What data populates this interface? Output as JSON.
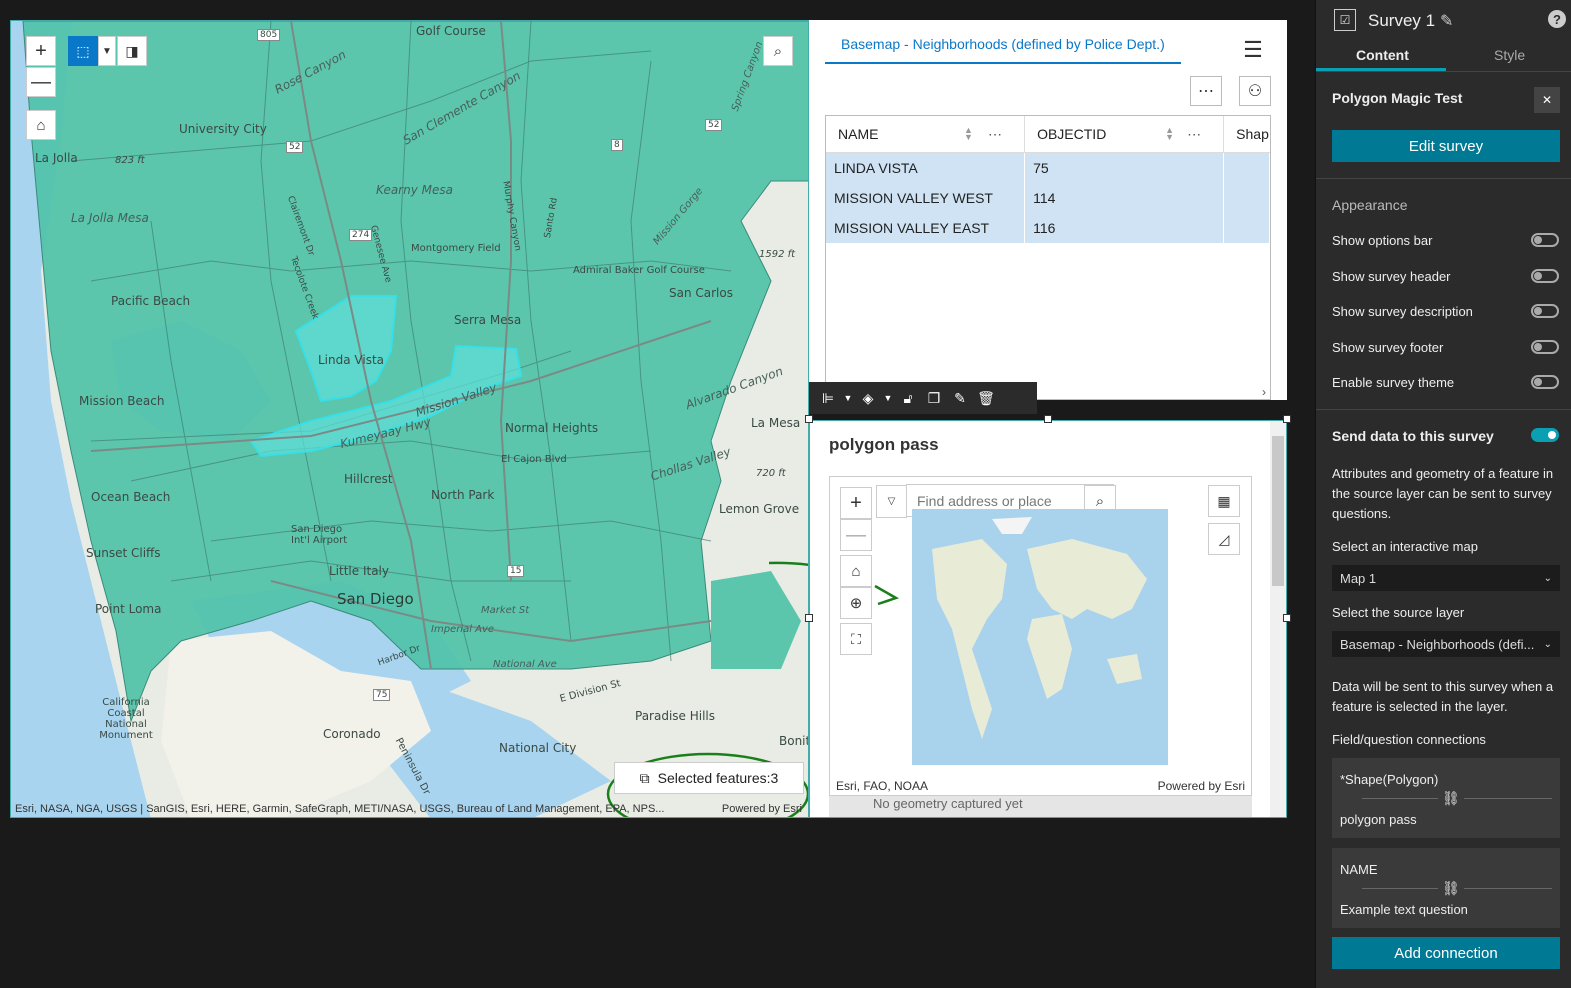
{
  "map": {
    "labels": [
      "Golf Course",
      "University City",
      "La Jolla",
      "La Jolla Mesa",
      "Kearny Mesa",
      "Montgomery Field",
      "Admiral Baker Golf Course",
      "Pacific Beach",
      "Serra Mesa",
      "San Carlos",
      "Linda Vista",
      "Mission Beach",
      "Mission Valley",
      "Kumeyaay Hwy",
      "La Mesa",
      "Normal Heights",
      "El Cajon Blvd",
      "Ocean Beach",
      "Hillcrest",
      "North Park",
      "Lemon Grove",
      "Sunset Cliffs",
      "San Diego Int'l Airport",
      "Little Italy",
      "San Diego",
      "Point Loma",
      "Market St",
      "Imperial Ave",
      "National Ave",
      "California Coastal National Monument",
      "Coronado",
      "National City",
      "Paradise Hills",
      "Rose Canyon",
      "San Clemente Canyon",
      "Alvarado Canyon",
      "Chollas Valley",
      "Spring Canyon",
      "Mission Gorge",
      "Clairemont Dr",
      "Santo Rd",
      "Murphy Canyon",
      "Genesee Ave",
      "Tecolote Creek",
      "Harbor Dr",
      "E Division St",
      "Peninsula Dr",
      "720 ft",
      "1592 ft",
      "823 ft",
      "Bonit"
    ],
    "shields": [
      "805",
      "52",
      "274",
      "52",
      "15",
      "75",
      "8"
    ],
    "attribution": "Esri, NASA, NGA, USGS | SanGIS, Esri, HERE, Garmin, SafeGraph, METI/NASA, USGS, Bureau of Land Management, EPA, NPS...",
    "powered": "Powered by Esri",
    "selected_features": "Selected features:3",
    "zoom_in": "+",
    "zoom_out": "—"
  },
  "table": {
    "tab_label": "Basemap - Neighborhoods (defined by Police Dept.)",
    "columns": [
      "NAME",
      "OBJECTID",
      "Shap"
    ],
    "rows": [
      {
        "name": "LINDA VISTA",
        "objectid": "75"
      },
      {
        "name": "MISSION VALLEY WEST",
        "objectid": "114"
      },
      {
        "name": "MISSION VALLEY EAST",
        "objectid": "116"
      }
    ],
    "more_glyph": "⋯",
    "more_glyph_2": "⋯",
    "more_glyph_3": "⋯"
  },
  "survey_widget": {
    "title": "polygon pass",
    "search_placeholder": "Find address or place",
    "attribution": "Esri, FAO, NOAA",
    "powered": "Powered by Esri",
    "no_geometry": "No geometry captured yet"
  },
  "sidebar": {
    "title": "Survey 1",
    "tabs": [
      "Content",
      "Style"
    ],
    "survey_name": "Polygon Magic Test",
    "close_glyph": "✕",
    "help_glyph": "?",
    "edit_button": "Edit survey",
    "appearance_heading": "Appearance",
    "toggles": [
      {
        "label": "Show options bar",
        "on": false
      },
      {
        "label": "Show survey header",
        "on": false
      },
      {
        "label": "Show survey description",
        "on": false
      },
      {
        "label": "Show survey footer",
        "on": false
      },
      {
        "label": "Enable survey theme",
        "on": false
      }
    ],
    "send_data_label": "Send data to this survey",
    "send_data_on": true,
    "send_desc": "Attributes and geometry of a feature in the source layer can be sent to survey questions.",
    "map_label": "Select an interactive map",
    "map_value": "Map 1",
    "layer_label": "Select the source layer",
    "layer_value": "Basemap - Neighborhoods (defi...",
    "data_note": "Data will be sent to this survey when a feature is selected in the layer.",
    "connections_label": "Field/question connections",
    "connections": [
      {
        "field": "*Shape(Polygon)",
        "question": "polygon pass"
      },
      {
        "field": "NAME",
        "question": "Example text question"
      }
    ],
    "add_button": "Add connection"
  },
  "colors": {
    "accent_blue": "#0a78c8",
    "teal_button": "#007a94",
    "toggle_on": "#0aa0b4",
    "polygon_fill": "#4fc2a8",
    "selected_outline": "#36e0e8",
    "annotation_green": "#1a7f1a"
  }
}
